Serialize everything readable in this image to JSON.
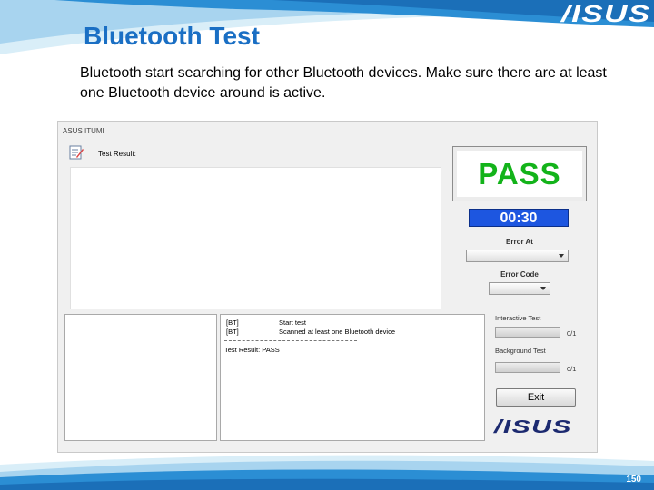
{
  "brand": {
    "logo_text": "/ISUS",
    "colors": {
      "title_blue": "#1a6fc4",
      "banner_blue": "#2b8ed4",
      "pass_green": "#13b31a",
      "timer_blue": "#1d56e0"
    }
  },
  "slide": {
    "title": "Bluetooth Test",
    "description": "Bluetooth start searching for other Bluetooth devices. Make sure there are at least one Bluetooth device around is active.",
    "page_number": "150"
  },
  "app": {
    "window_title": "ASUS ITUMI",
    "result_label": "Test Result:",
    "status": "PASS",
    "timer": "00:30",
    "error_at_label": "Error At",
    "error_at_value": "",
    "error_code_label": "Error Code",
    "error_code_value": "",
    "interactive_test_label": "Interactive Test",
    "interactive_test_count": "0/1",
    "interactive_test_progress": 0,
    "background_test_label": "Background Test",
    "background_test_count": "0/1",
    "background_test_progress": 0,
    "exit_label": "Exit",
    "logo_text": "/ISUS",
    "log": [
      {
        "tag": "[BT]",
        "message": "Start test"
      },
      {
        "tag": "[BT]",
        "message": "Scanned at least one Bluetooth device"
      }
    ],
    "log_result": "Test Result: PASS"
  }
}
